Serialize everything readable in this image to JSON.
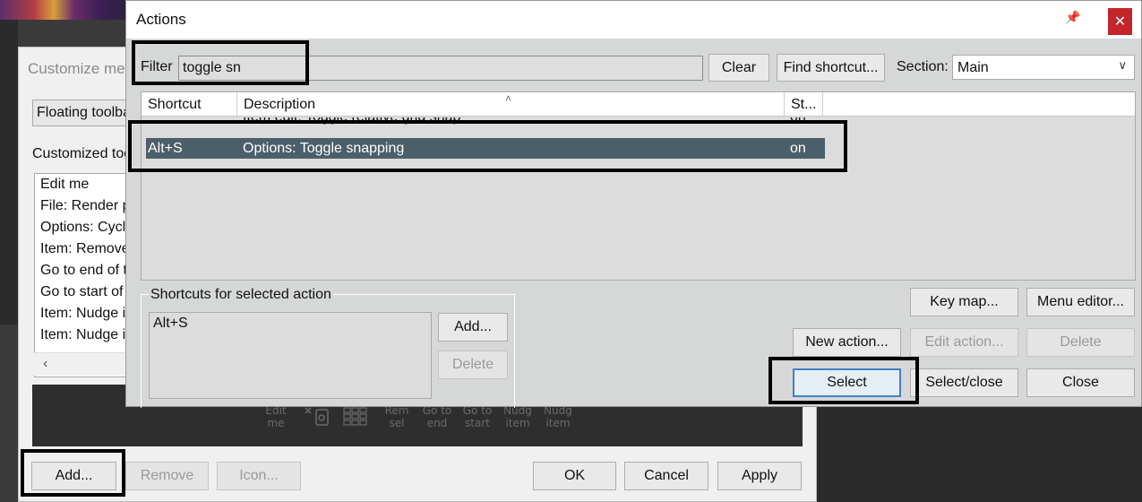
{
  "customize": {
    "title": "Customize me",
    "toolbar_combo": "Floating toolbar",
    "list_label": "Customized toolbar",
    "items": [
      "Edit me",
      "File: Render p",
      "Options: Cycle",
      "Item: Remove",
      "Go to end of t",
      "Go to start of",
      "Item: Nudge it",
      "Item: Nudge it"
    ],
    "preview_labels": [
      "Edit me",
      "Rem sel",
      "Go to end",
      "Go to start",
      "Nudg item",
      "Nudg item"
    ],
    "buttons": {
      "add": "Add...",
      "remove": "Remove",
      "icon": "Icon...",
      "ok": "OK",
      "cancel": "Cancel",
      "apply": "Apply"
    }
  },
  "actions": {
    "title": "Actions",
    "close_glyph": "✕",
    "pin_glyph": "📌",
    "filter_label": "Filter",
    "filter_value": "toggle sn",
    "clear": "Clear",
    "find_shortcut": "Find shortcut...",
    "section_label": "Section:",
    "section_value": "Main",
    "columns": {
      "shortcut": "Shortcut",
      "description": "Description",
      "state": "St..."
    },
    "rows": [
      {
        "shortcut": "",
        "description": "Item edit: Toggle relative grid snap",
        "state": "on"
      },
      {
        "shortcut": "Alt+S",
        "description": "Options: Toggle snapping",
        "state": "on"
      }
    ],
    "shortcuts_legend": "Shortcuts for selected action",
    "shortcuts": [
      "Alt+S"
    ],
    "buttons": {
      "shortcut_add": "Add...",
      "shortcut_delete": "Delete",
      "key_map": "Key map...",
      "menu_editor": "Menu editor...",
      "new_action": "New action...",
      "edit_action": "Edit action...",
      "delete": "Delete",
      "select": "Select",
      "select_close": "Select/close",
      "close": "Close"
    }
  },
  "colors": {
    "selected_row": "#4b5f6a",
    "close_button": "#c2262b",
    "focus_border": "#3f83c8"
  }
}
